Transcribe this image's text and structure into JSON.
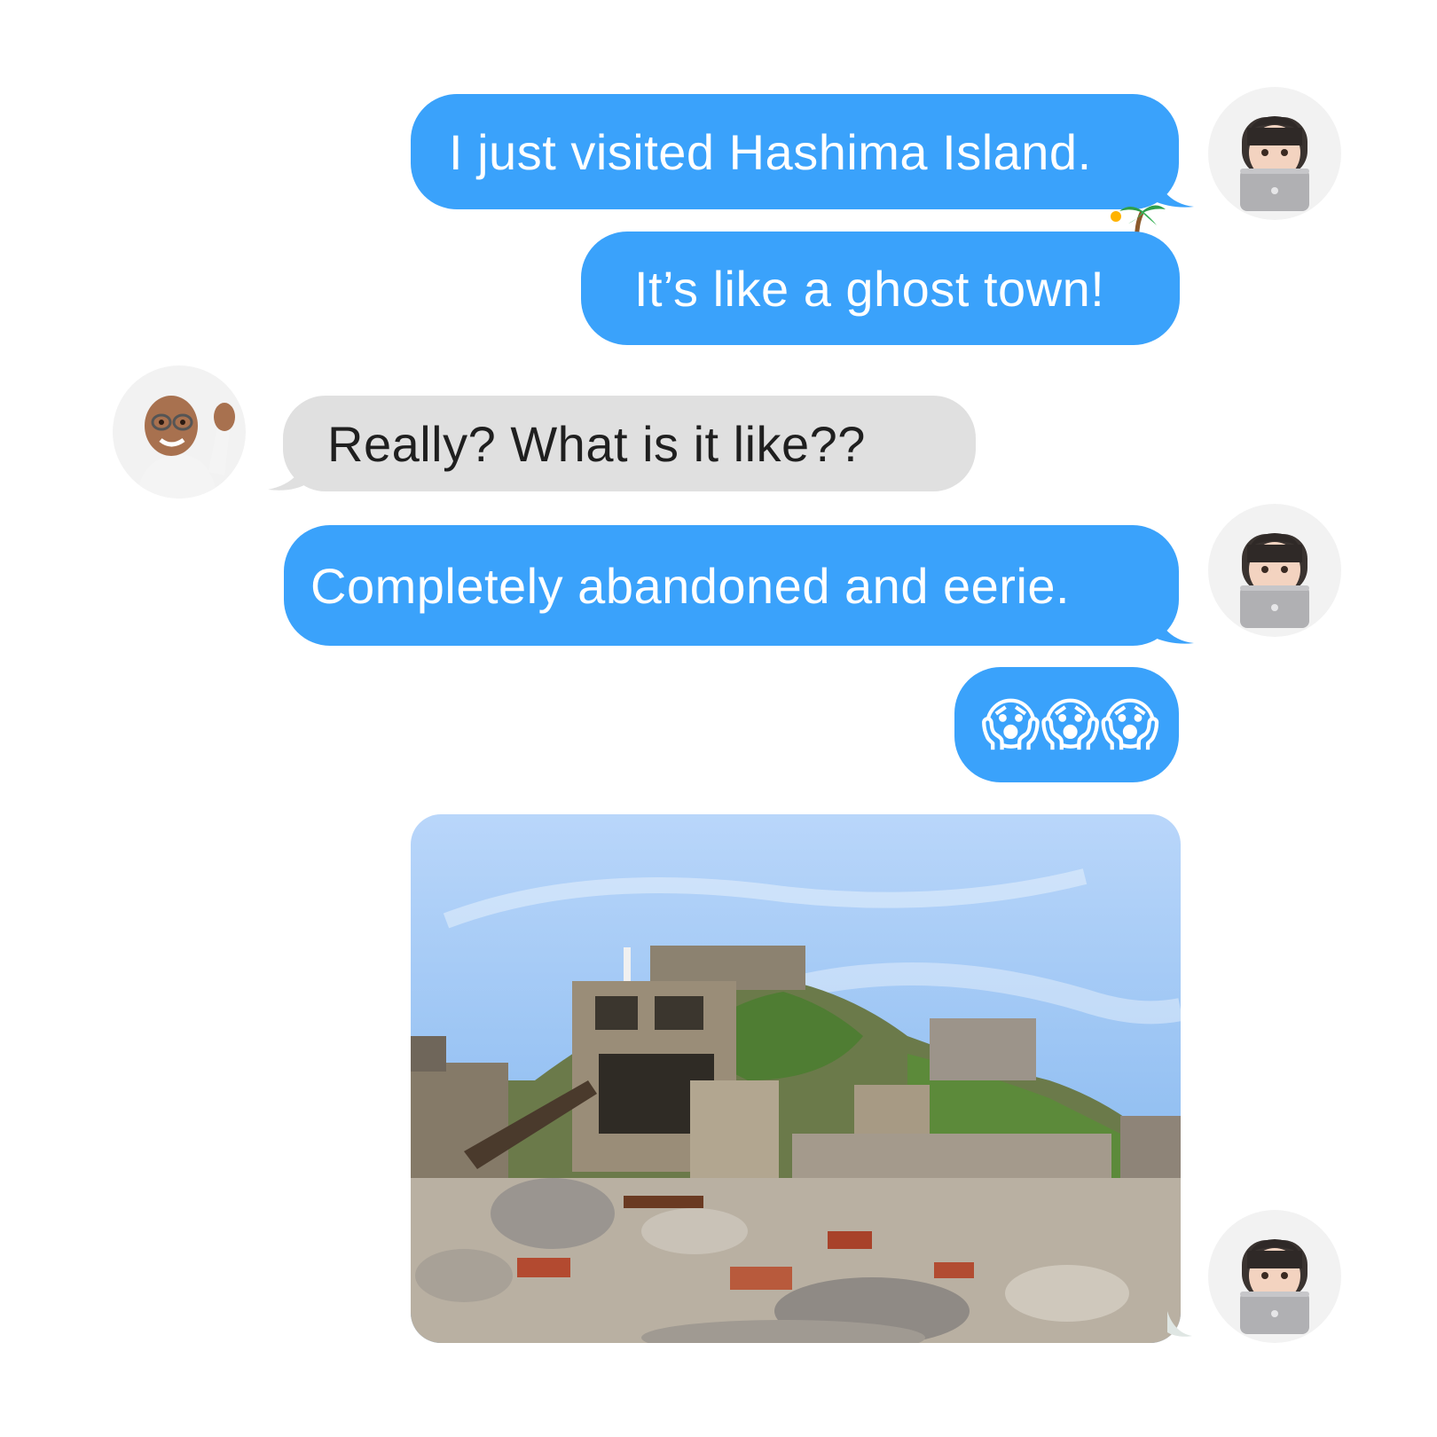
{
  "conversation": {
    "messages": [
      {
        "id": "m1",
        "sender": "me",
        "text": "I just visited Hashima Island.",
        "reaction": "desert-island-emoji"
      },
      {
        "id": "m2",
        "sender": "me",
        "text": "It’s like a ghost town!"
      },
      {
        "id": "m3",
        "sender": "friend",
        "text": "Really? What is it like??"
      },
      {
        "id": "m4",
        "sender": "me",
        "text": "Completely abandoned and eerie."
      },
      {
        "id": "m5",
        "sender": "me",
        "text": "😱😱😱"
      },
      {
        "id": "m6",
        "sender": "me",
        "type": "photo",
        "subject": "hashima-island-ruins-photo"
      }
    ]
  },
  "participants": {
    "me": {
      "avatar": "memoji-girl-laptop"
    },
    "friend": {
      "avatar": "memoji-man-waving"
    }
  },
  "colors": {
    "outgoing_bubble": "#3aa2fb",
    "incoming_bubble": "#e0e0e0",
    "outgoing_text": "#ffffff",
    "incoming_text": "#1f1f1f",
    "background": "#ffffff"
  }
}
